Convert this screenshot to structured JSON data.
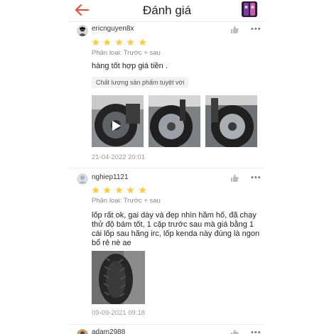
{
  "header": {
    "title": "Đánh giá"
  },
  "reviews": [
    {
      "username": "ericnguyen8x",
      "rating": 5,
      "variant": "Phân loại: Trước + sau",
      "text": "hàng tốt hợp giá tiền .",
      "tag": "Chất lượng sản phẩm tuyệt vời",
      "photo_count": 3,
      "has_video": true,
      "date": "21-04-2022 20:01"
    },
    {
      "username": "nghiep1121",
      "rating": 5,
      "variant": "Phân loại: Trước + sau",
      "text": "lốp rất ok, gai dày và đẹp nhìn hầm hố, đã chạy thử độ bám tốt, 1 cặp trước sau mà giá bằng 1 cái lốp sau hãng irc, lốp kenda này đúng là ngon bổ rẻ nè ae",
      "photo_count": 1,
      "date": "09-09-2021 09:18"
    },
    {
      "username": "adam2988"
    }
  ],
  "colors": {
    "accent": "#ee4d2d",
    "star": "#ffce3d"
  }
}
